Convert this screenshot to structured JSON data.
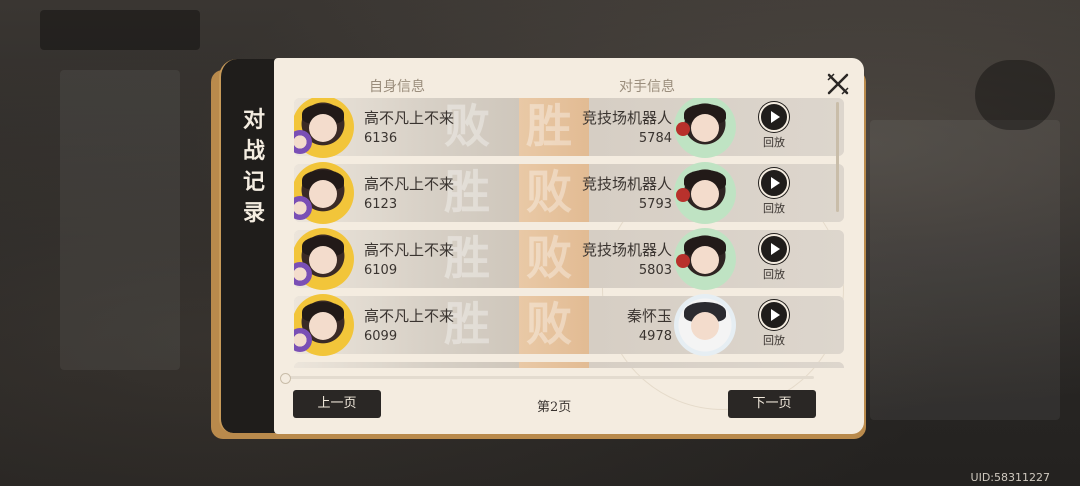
{
  "dialog": {
    "title": "对战记录",
    "headers": {
      "self": "自身信息",
      "opponent": "对手信息"
    },
    "replay_label": "回放",
    "rows": [
      {
        "self_name": "高不凡上不来",
        "self_score": "6136",
        "result_left": "败",
        "result_right": "胜",
        "opp_name": "竞技场机器人",
        "opp_score": "5784"
      },
      {
        "self_name": "高不凡上不来",
        "self_score": "6123",
        "result_left": "胜",
        "result_right": "败",
        "opp_name": "竞技场机器人",
        "opp_score": "5793"
      },
      {
        "self_name": "高不凡上不来",
        "self_score": "6109",
        "result_left": "胜",
        "result_right": "败",
        "opp_name": "竞技场机器人",
        "opp_score": "5803"
      },
      {
        "self_name": "高不凡上不来",
        "self_score": "6099",
        "result_left": "胜",
        "result_right": "败",
        "opp_name": "秦怀玉",
        "opp_score": "4978"
      }
    ],
    "pagination": {
      "prev_label": "上一页",
      "page_label": "第2页",
      "next_label": "下一页"
    }
  },
  "uid": "UID:58311227",
  "colors": {
    "frame": "#b98a4c",
    "panel": "#f4ece0",
    "dark": "#201d1b",
    "result_band": "#e2bb93"
  }
}
